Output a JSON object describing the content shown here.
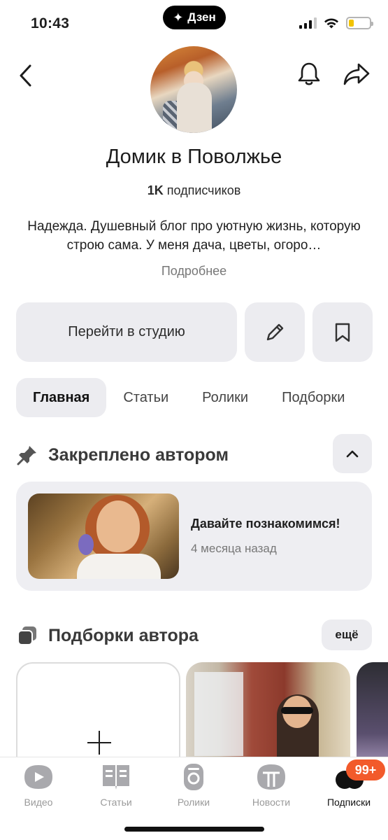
{
  "status_bar": {
    "time": "10:43",
    "app_pill": "Дзен",
    "battery_level": 0.25
  },
  "header": {
    "back_icon": "chevron-left-icon",
    "bell_icon": "bell-icon",
    "share_icon": "share-arrow-icon"
  },
  "channel": {
    "title": "Домик в Поволжье",
    "subscribers_count": "1K",
    "subscribers_label": " подписчиков",
    "description": "Надежда. Душевный блог про уютную жизнь, которую строю сама. У меня дача, цветы, огоро…",
    "more_link": "Подробнее"
  },
  "actions": {
    "studio_button": "Перейти в студию",
    "edit_icon": "pencil-icon",
    "bookmark_icon": "bookmark-icon"
  },
  "tabs": [
    {
      "label": "Главная",
      "active": true
    },
    {
      "label": "Статьи",
      "active": false
    },
    {
      "label": "Ролики",
      "active": false
    },
    {
      "label": "Подборки",
      "active": false
    }
  ],
  "pinned": {
    "section_title": "Закреплено автором",
    "icon": "pin-icon",
    "collapse_icon": "chevron-up-icon",
    "card_title": "Давайте познакомимся!",
    "card_date": "4 месяца назад"
  },
  "collections": {
    "section_title": "Подборки автора",
    "icon": "collections-icon",
    "more_button": "ещё",
    "create_icon": "plus-icon"
  },
  "bottom_nav": {
    "items": [
      {
        "label": "Видео",
        "icon": "video-icon",
        "active": false
      },
      {
        "label": "Статьи",
        "icon": "articles-icon",
        "active": false
      },
      {
        "label": "Ролики",
        "icon": "shorts-icon",
        "active": false
      },
      {
        "label": "Новости",
        "icon": "news-icon",
        "active": false
      },
      {
        "label": "Подписки",
        "icon": "subscriptions-icon",
        "active": true
      }
    ],
    "badge": "99+"
  },
  "colors": {
    "accent_badge": "#f25a2b",
    "button_bg": "#ececf0",
    "card_bg": "#eeeef2"
  }
}
